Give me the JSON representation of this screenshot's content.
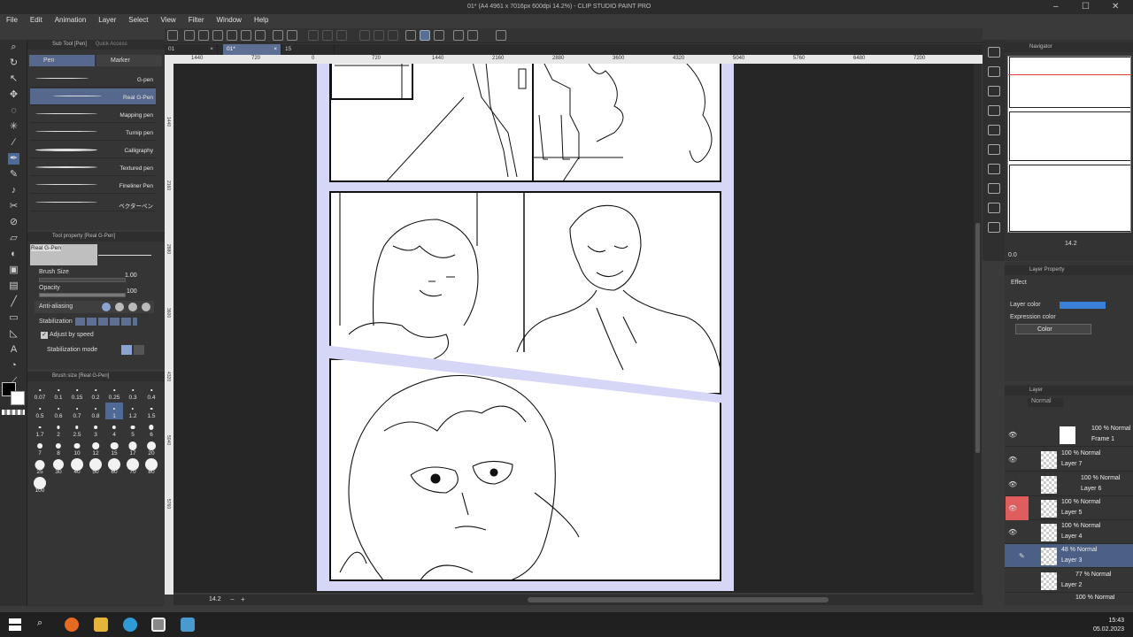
{
  "window": {
    "title": "01* (A4 4961 x 7016px 600dpi 14.2%) - CLIP STUDIO PAINT PRO",
    "controls": [
      "–",
      "☐",
      "✕"
    ]
  },
  "menu": [
    "File",
    "Edit",
    "Animation",
    "Layer",
    "Select",
    "View",
    "Filter",
    "Window",
    "Help"
  ],
  "subtool_panel": {
    "title": "Sub Tool [Pen]",
    "title2": "Quick Access",
    "tabs": [
      "Pen",
      "Marker"
    ],
    "brushes": [
      "G-pen",
      "Real G-Pen",
      "Mapping pen",
      "Turnip pen",
      "Calligraphy",
      "Textured pen",
      "Fineliner Pen",
      "ベクターペン"
    ],
    "selected_index": 1
  },
  "tool_property": {
    "title": "Tool property [Real G-Pen]",
    "preview_label": "Real G-Pen",
    "brush_size_label": "Brush Size",
    "brush_size_value": "1.00",
    "opacity_label": "Opacity",
    "opacity_value": "100",
    "antialiasing_label": "Anti-aliasing",
    "stabilization_label": "Stabilization",
    "adjust_by_speed": "Adjust by speed",
    "stabilization_mode": "Stabilization mode"
  },
  "brush_size_panel": {
    "title": "Brush size [Real G-Pen]",
    "sizes": [
      "0.07",
      "0.1",
      "0.15",
      "0.2",
      "0.25",
      "0.3",
      "0.4",
      "0.5",
      "0.6",
      "0.7",
      "0.8",
      "1",
      "1.2",
      "1.5",
      "1.7",
      "2",
      "2.5",
      "3",
      "4",
      "5",
      "6",
      "7",
      "8",
      "10",
      "12",
      "15",
      "17",
      "20",
      "25",
      "30",
      "40",
      "50",
      "60",
      "70",
      "80",
      "100"
    ],
    "selected": "1"
  },
  "doc_tabs": [
    {
      "label": "01"
    },
    {
      "label": "01*"
    },
    {
      "label": "15"
    }
  ],
  "ruler_h_labels": [
    "1440",
    "720",
    "0",
    "720",
    "1440",
    "2160",
    "2880",
    "3600",
    "4320",
    "5040",
    "5760",
    "6480",
    "7200"
  ],
  "ruler_v_labels": [
    "1440",
    "2160",
    "2880",
    "3600",
    "4320",
    "5040",
    "5760"
  ],
  "canvas_footer": {
    "zoom": "14.2"
  },
  "navigator": {
    "title": "Navigator",
    "zoom": "14.2",
    "angle": "0.0"
  },
  "layer_property": {
    "title": "Layer Property",
    "effect_label": "Effect",
    "layer_color_label": "Layer color",
    "layer_color_value": "#3a7fd8",
    "expression_color_label": "Expression color",
    "expression_color_value": "Color"
  },
  "layer_panel": {
    "title": "Layer",
    "blend_mode": "Normal",
    "layers": [
      {
        "blend": "100 % Normal",
        "name": "Frame 1",
        "folder": true
      },
      {
        "blend": "100 % Normal",
        "name": "Layer 7"
      },
      {
        "blend": "100 % Normal",
        "name": "Layer 6"
      },
      {
        "blend": "100 % Normal",
        "name": "Layer 5",
        "highlight": true
      },
      {
        "blend": "100 % Normal",
        "name": "Layer 4"
      },
      {
        "blend": "48 % Normal",
        "name": "Layer 3",
        "selected": true
      },
      {
        "blend": "77 % Normal",
        "name": "Layer 2"
      },
      {
        "blend": "100 % Normal",
        "name": ""
      }
    ]
  },
  "taskbar": {
    "time": "15:43",
    "date": "05.02.2023"
  }
}
